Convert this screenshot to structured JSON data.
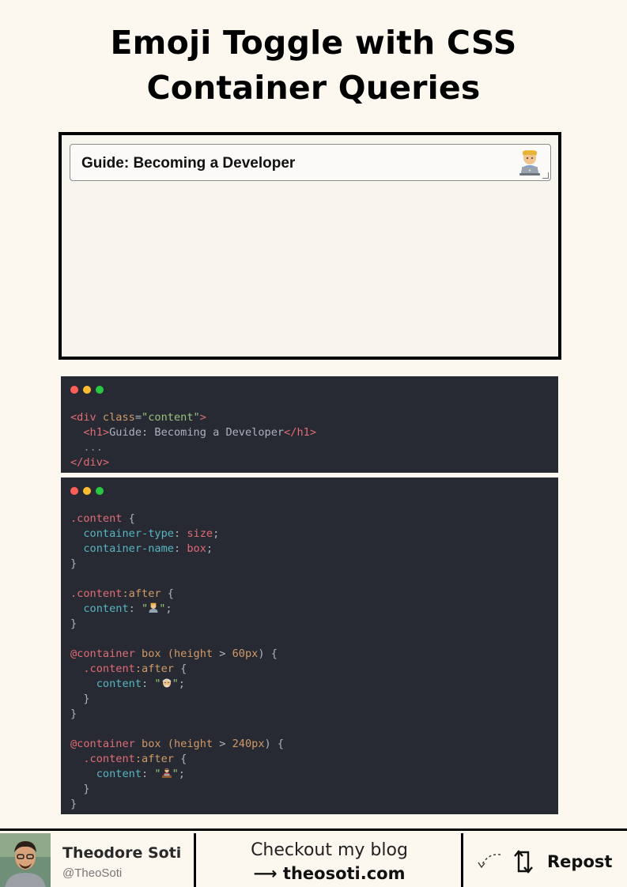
{
  "title": {
    "line1": "Emoji Toggle with CSS",
    "line2": "Container Queries"
  },
  "demo": {
    "heading": "Guide: Becoming a Developer",
    "emoji_icon": "technologist-emoji-icon"
  },
  "html_code": {
    "lines": [
      {
        "open": "<div ",
        "attr": "class",
        "eq": "=",
        "str": "\"content\"",
        "close": ">"
      },
      {
        "indent": "  ",
        "open": "<h1>",
        "text": "Guide: Becoming a Developer",
        "close": "</h1>"
      },
      {
        "indent": "  ",
        "text": "..."
      },
      {
        "close": "</div>"
      }
    ]
  },
  "css_code": {
    "block1": {
      "selector": ".content",
      "brace": " {",
      "prop1": "container-type",
      "val1": "size",
      "prop2": "container-name",
      "val2": "box",
      "close": "}"
    },
    "block2": {
      "selector": ".content",
      "pseudo": ":after",
      "brace": " {",
      "prop": "content",
      "q_open": "\"",
      "q_close": "\"",
      "close": "}"
    },
    "block3": {
      "at": "@container",
      "name": " box (",
      "feat": "height",
      "op": " > ",
      "num": "60px",
      "end": ") {",
      "selector": ".content",
      "pseudo": ":after",
      "brace": " {",
      "prop": "content",
      "q_open": "\"",
      "q_close": "\"",
      "close_inner": "}",
      "close": "}"
    },
    "block4": {
      "at": "@container",
      "name": " box (",
      "feat": "height",
      "op": " > ",
      "num": "240px",
      "end": ") {",
      "selector": ".content",
      "pseudo": ":after",
      "brace": " {",
      "prop": "content",
      "q_open": "\"",
      "q_close": "\"",
      "close_inner": "}",
      "close": "}"
    }
  },
  "footer": {
    "author_name": "Theodore Soti",
    "author_handle": "@TheoSoti",
    "blog_line1": "Checkout my blog",
    "blog_line2": "⟶ theosoti.com",
    "repost_label": "Repost"
  },
  "colors": {
    "background": "#fcf7ef",
    "code_bg": "#272a33",
    "tag": "#e06c75",
    "attr": "#d19a66",
    "string": "#98c379",
    "property": "#56b6c2"
  }
}
